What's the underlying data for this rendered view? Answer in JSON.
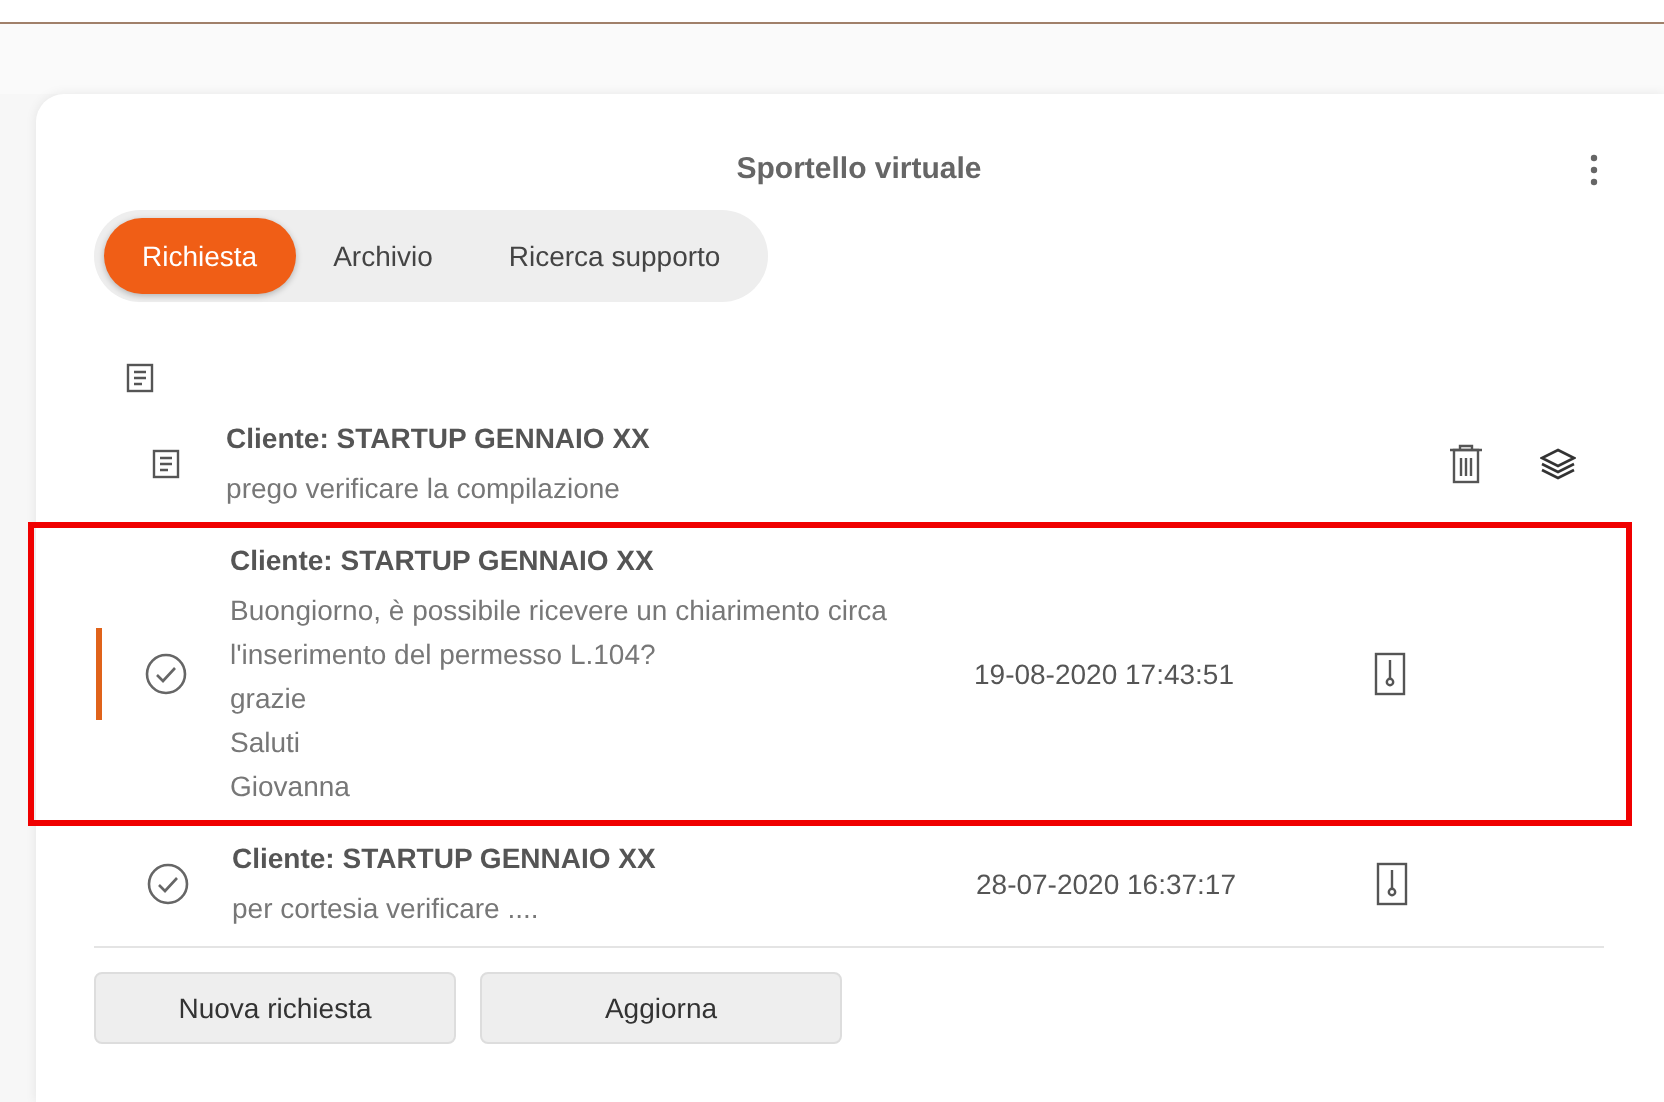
{
  "title": "Sportello virtuale",
  "tabs": [
    {
      "label": "Richiesta",
      "selected": true
    },
    {
      "label": "Archivio",
      "selected": false
    },
    {
      "label": "Ricerca supporto",
      "selected": false
    }
  ],
  "rows": [
    {
      "kind": "draft",
      "title": "Cliente: STARTUP GENNAIO XX",
      "lines": [
        "prego verificare la compilazione"
      ],
      "highlighted": false,
      "marked": false
    },
    {
      "kind": "sent",
      "title": "Cliente: STARTUP GENNAIO XX",
      "lines": [
        "Buongiorno, è possibile ricevere un chiarimento circa",
        "l'inserimento del permesso L.104?",
        "grazie",
        "Saluti",
        "Giovanna"
      ],
      "date": "19-08-2020 17:43:51",
      "highlighted": true,
      "marked": true
    },
    {
      "kind": "sent",
      "title": "Cliente: STARTUP GENNAIO XX",
      "lines": [
        "per cortesia verificare ...."
      ],
      "date": "28-07-2020 16:37:17",
      "highlighted": false,
      "marked": false
    }
  ],
  "buttons": [
    "Nuova richiesta",
    "Aggiorna"
  ]
}
